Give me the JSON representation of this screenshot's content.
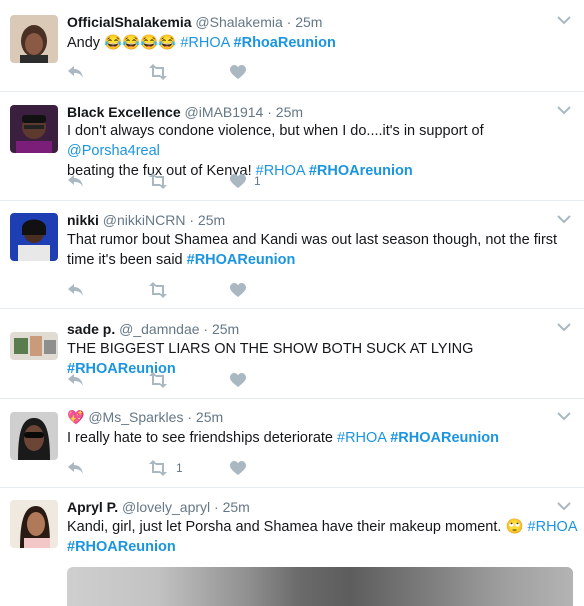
{
  "tweets": [
    {
      "name": "OfficialShalakemia",
      "handle": "@Shalakemia",
      "sep": "·",
      "time": "25m",
      "text": "Andy 😂😂😂😂",
      "tags": [
        "#RHOA",
        "#RhoaReunion"
      ],
      "likes": ""
    },
    {
      "name": "Black Excellence",
      "handle": "@iMAB1914",
      "sep": "·",
      "time": "25m",
      "text_line1": "I don't always condone violence, but when I do....it's in support of",
      "mention": "@Porsha4real",
      "text_line2": "beating the fux out of Kenya!",
      "tags": [
        "#RHOA",
        "#RHOAreunion"
      ],
      "likes": "1"
    },
    {
      "name": "nikki",
      "handle": "@nikkiNCRN",
      "sep": "·",
      "time": "25m",
      "text_line1": "That rumor bout Shamea and Kandi was out last season though, not the first",
      "text_line2": "time it's been said",
      "tags": [
        "#RHOAReunion"
      ],
      "likes": ""
    },
    {
      "name": "sade p.",
      "handle": "@_damndae",
      "sep": "·",
      "time": "25m",
      "text": "THE BIGGEST LIARS ON THE SHOW BOTH SUCK AT LYING",
      "tags": [
        "#RHOAReunion"
      ],
      "likes": ""
    },
    {
      "name": "💖",
      "handle": "@Ms_Sparkles",
      "sep": "·",
      "time": "25m",
      "text": "I really hate to see friendships deteriorate",
      "tags": [
        "#RHOA",
        "#RHOAReunion"
      ],
      "retweets": "1",
      "likes": ""
    },
    {
      "name": "Apryl P.",
      "handle": "@lovely_apryl",
      "sep": "·",
      "time": "25m",
      "text": "Kandi, girl, just let Porsha and Shamea have their makeup moment. 🙄",
      "tags": [
        "#RHOA",
        "#RHOAReunion"
      ]
    }
  ],
  "colors": {
    "link": "#1b95e0",
    "icon": "#aab8c2",
    "border": "#e6ecf0"
  },
  "icons": [
    "reply-icon",
    "retweet-icon",
    "heart-icon",
    "chevron-down-icon"
  ]
}
